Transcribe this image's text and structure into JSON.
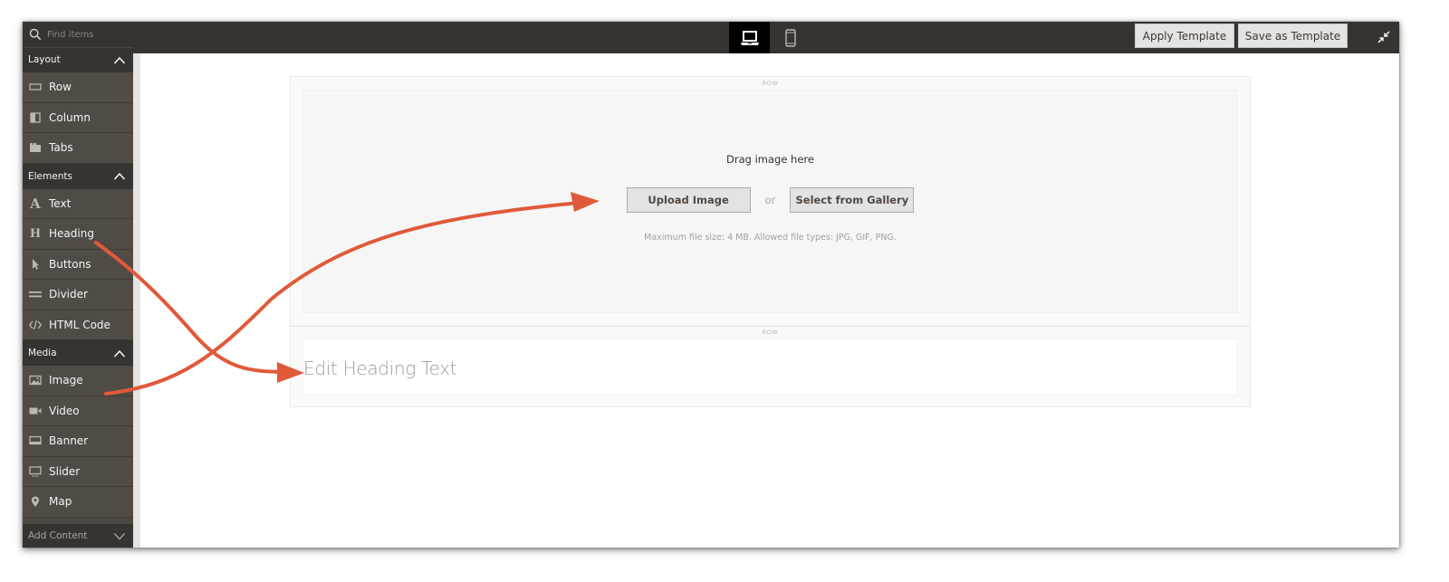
{
  "toolbar": {
    "search_placeholder": "Find items",
    "devices": [
      {
        "name": "desktop",
        "active": true
      },
      {
        "name": "mobile",
        "active": false
      }
    ],
    "apply_template_label": "Apply Template",
    "save_as_template_label": "Save as Template"
  },
  "sidebar": {
    "groups": [
      {
        "label": "Layout",
        "expanded": true,
        "items": [
          {
            "label": "Row",
            "icon": "row-icon"
          },
          {
            "label": "Column",
            "icon": "column-icon"
          },
          {
            "label": "Tabs",
            "icon": "tabs-icon"
          }
        ]
      },
      {
        "label": "Elements",
        "expanded": true,
        "items": [
          {
            "label": "Text",
            "icon": "text-icon"
          },
          {
            "label": "Heading",
            "icon": "heading-icon"
          },
          {
            "label": "Buttons",
            "icon": "cursor-icon"
          },
          {
            "label": "Divider",
            "icon": "divider-icon"
          },
          {
            "label": "HTML Code",
            "icon": "code-icon"
          }
        ]
      },
      {
        "label": "Media",
        "expanded": true,
        "items": [
          {
            "label": "Image",
            "icon": "image-icon"
          },
          {
            "label": "Video",
            "icon": "video-icon"
          },
          {
            "label": "Banner",
            "icon": "banner-icon"
          },
          {
            "label": "Slider",
            "icon": "slider-icon"
          },
          {
            "label": "Map",
            "icon": "map-pin-icon"
          }
        ]
      }
    ],
    "footer_label": "Add Content"
  },
  "canvas": {
    "row_label": "ROW",
    "image_block": {
      "drag_text": "Drag image here",
      "upload_label": "Upload Image",
      "or_text": "or",
      "gallery_label": "Select from Gallery",
      "file_info": "Maximum file size: 4 MB. Allowed file types: JPG, GIF, PNG."
    },
    "heading_block": {
      "placeholder_text": "Edit Heading Text"
    }
  },
  "annotations": {
    "arrow_color": "#e05a3a",
    "arrows": [
      {
        "from": "Heading",
        "to": "Edit Heading Text"
      },
      {
        "from": "Image",
        "to": "Upload Image"
      }
    ]
  },
  "colors": {
    "topbar": "#373330",
    "sidebar_item": "#514b46",
    "sidebar_header": "#373330",
    "button": "#e3e3e3"
  }
}
